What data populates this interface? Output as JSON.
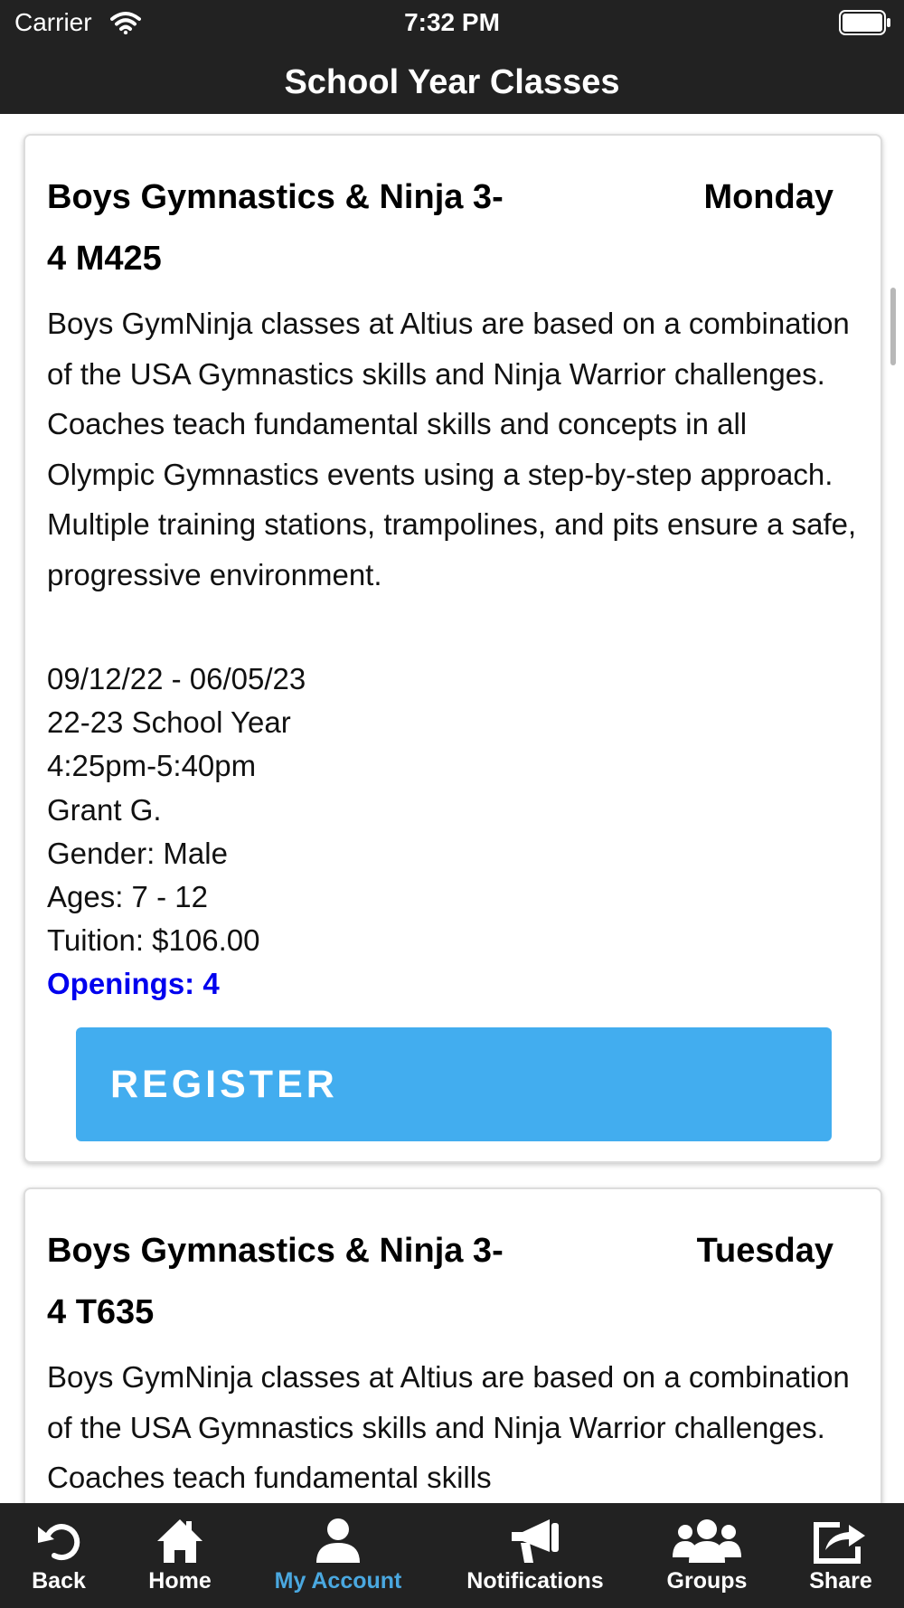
{
  "status_bar": {
    "carrier": "Carrier",
    "time": "7:32 PM"
  },
  "nav": {
    "title": "School Year Classes"
  },
  "classes": [
    {
      "title": "Boys Gymnastics & Ninja 3-4 M425",
      "title_line1": "Boys Gymnastics & Ninja 3-",
      "title_line2": "4 M425",
      "day": "Monday",
      "description": "Boys GymNinja classes at Altius are based on a combination of the USA Gymnastics skills and Ninja Warrior challenges. Coaches teach fundamental skills and concepts in all Olympic Gymnastics events using a step-by-step approach. Multiple training stations, trampolines, and pits ensure a safe, progressive environment.",
      "dates": "09/12/22 - 06/05/23",
      "session": "22-23 School Year",
      "time": "4:25pm-5:40pm",
      "instructor": "Grant G.",
      "gender": "Gender: Male",
      "ages": "Ages: 7 - 12",
      "tuition": "Tuition: $106.00",
      "openings": "Openings: 4",
      "register_label": "REGISTER"
    },
    {
      "title": "Boys Gymnastics & Ninja 3-4 T635",
      "title_line1": "Boys Gymnastics & Ninja 3-",
      "title_line2": "4 T635",
      "day": "Tuesday",
      "description": "Boys GymNinja classes at Altius are based on a combination of the USA Gymnastics skills and Ninja Warrior challenges. Coaches teach fundamental skills"
    }
  ],
  "tabs": [
    {
      "label": "Back",
      "icon": "back-icon"
    },
    {
      "label": "Home",
      "icon": "home-icon"
    },
    {
      "label": "My Account",
      "icon": "account-icon",
      "active": true
    },
    {
      "label": "Notifications",
      "icon": "megaphone-icon"
    },
    {
      "label": "Groups",
      "icon": "groups-icon"
    },
    {
      "label": "Share",
      "icon": "share-icon"
    }
  ],
  "colors": {
    "bar_background": "#222222",
    "register_button": "#42adef",
    "openings_text": "#0000ee",
    "active_tab": "#4aa8e0"
  }
}
